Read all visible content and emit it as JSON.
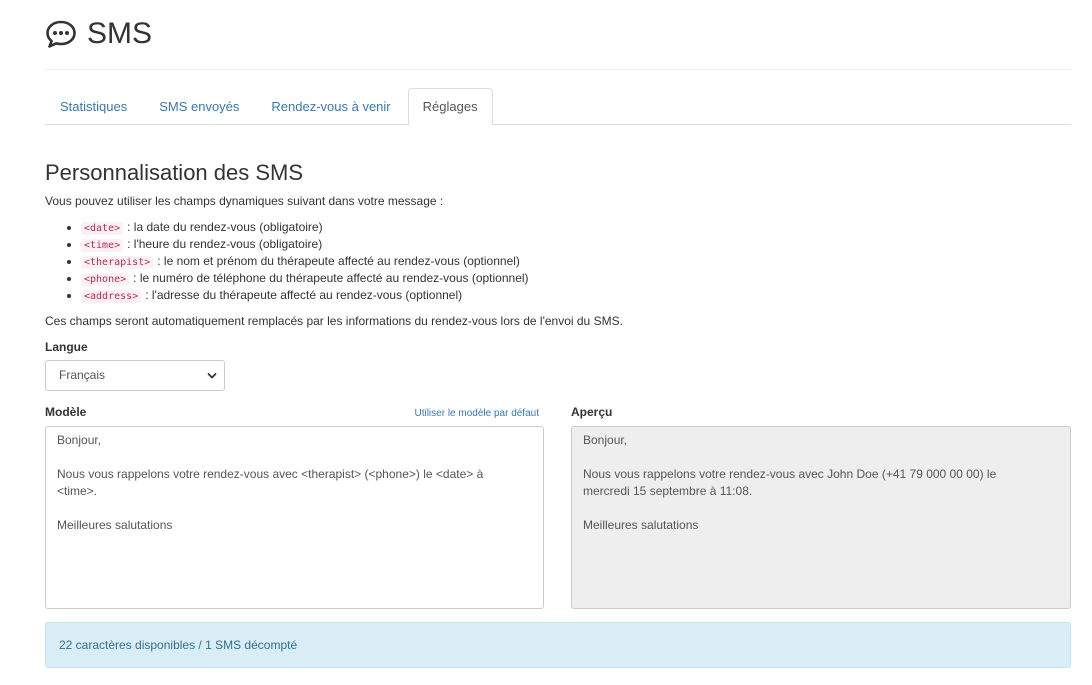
{
  "header": {
    "title": "SMS",
    "icon": "chat-bubble-icon"
  },
  "tabs": [
    {
      "label": "Statistiques",
      "active": false
    },
    {
      "label": "SMS envoyés",
      "active": false
    },
    {
      "label": "Rendez-vous à venir",
      "active": false
    },
    {
      "label": "Réglages",
      "active": true
    }
  ],
  "section": {
    "title": "Personnalisation des SMS",
    "intro": "Vous pouvez utiliser les champs dynamiques suivant dans votre message :",
    "fields": [
      {
        "code": "<date>",
        "description": ": la date du rendez-vous (obligatoire)"
      },
      {
        "code": "<time>",
        "description": ": l'heure du rendez-vous (obligatoire)"
      },
      {
        "code": "<therapist>",
        "description": ": le nom et prénom du thérapeute affecté au rendez-vous (optionnel)"
      },
      {
        "code": "<phone>",
        "description": ": le numéro de téléphone du thérapeute affecté au rendez-vous (optionnel)"
      },
      {
        "code": "<address>",
        "description": ": l'adresse du thérapeute affecté au rendez-vous (optionnel)"
      }
    ],
    "outro": "Ces champs seront automatiquement remplacés par les informations du rendez-vous lors de l'envoi du SMS."
  },
  "language": {
    "label": "Langue",
    "selected": "Français"
  },
  "template": {
    "label": "Modèle",
    "default_link": "Utiliser le modèle par défaut",
    "value": "Bonjour,\n\nNous vous rappelons votre rendez-vous avec <therapist> (<phone>) le <date> à\n<time>.\n\nMeilleures salutations"
  },
  "preview": {
    "label": "Aperçu",
    "value": "Bonjour,\n\nNous vous rappelons votre rendez-vous avec John Doe (+41 79 000 00 00) le\nmercredi 15 septembre à 11:08.\n\nMeilleures salutations"
  },
  "status": {
    "message": "22 caractères disponibles / 1 SMS décompté"
  },
  "colors": {
    "link": "#337ab7",
    "code_text": "#c7254e",
    "code_bg": "#f9f2f4",
    "alert_bg": "#d9edf7",
    "alert_text": "#31708f",
    "preview_bg": "#eeeeee"
  }
}
